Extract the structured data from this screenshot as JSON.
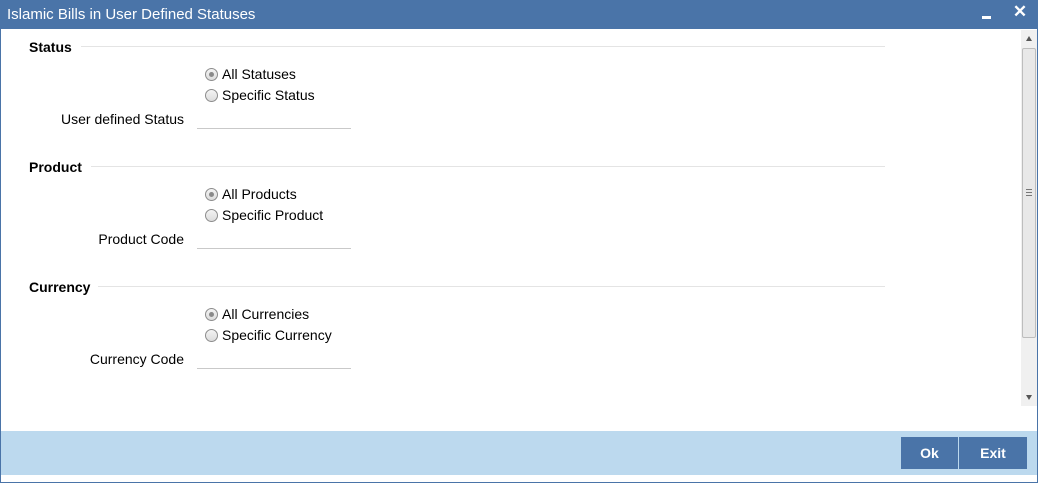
{
  "window": {
    "title": "Islamic Bills in User Defined Statuses",
    "close_glyph": "✕"
  },
  "sections": {
    "status": {
      "title": "Status",
      "options": [
        "All Statuses",
        "Specific Status"
      ],
      "selected": "All Statuses",
      "field_label": "User defined Status",
      "field_value": ""
    },
    "product": {
      "title": "Product",
      "options": [
        "All Products",
        "Specific Product"
      ],
      "selected": "All Products",
      "field_label": "Product Code",
      "field_value": ""
    },
    "currency": {
      "title": "Currency",
      "options": [
        "All Currencies",
        "Specific Currency"
      ],
      "selected": "All Currencies",
      "field_label": "Currency Code",
      "field_value": ""
    }
  },
  "footer": {
    "ok_label": "Ok",
    "exit_label": "Exit"
  },
  "colors": {
    "titlebar": "#4a74a8",
    "footer": "#bcd9ee",
    "button": "#4a74a8"
  },
  "icons": {
    "minimize": "minimize-icon",
    "close": "close-icon"
  }
}
